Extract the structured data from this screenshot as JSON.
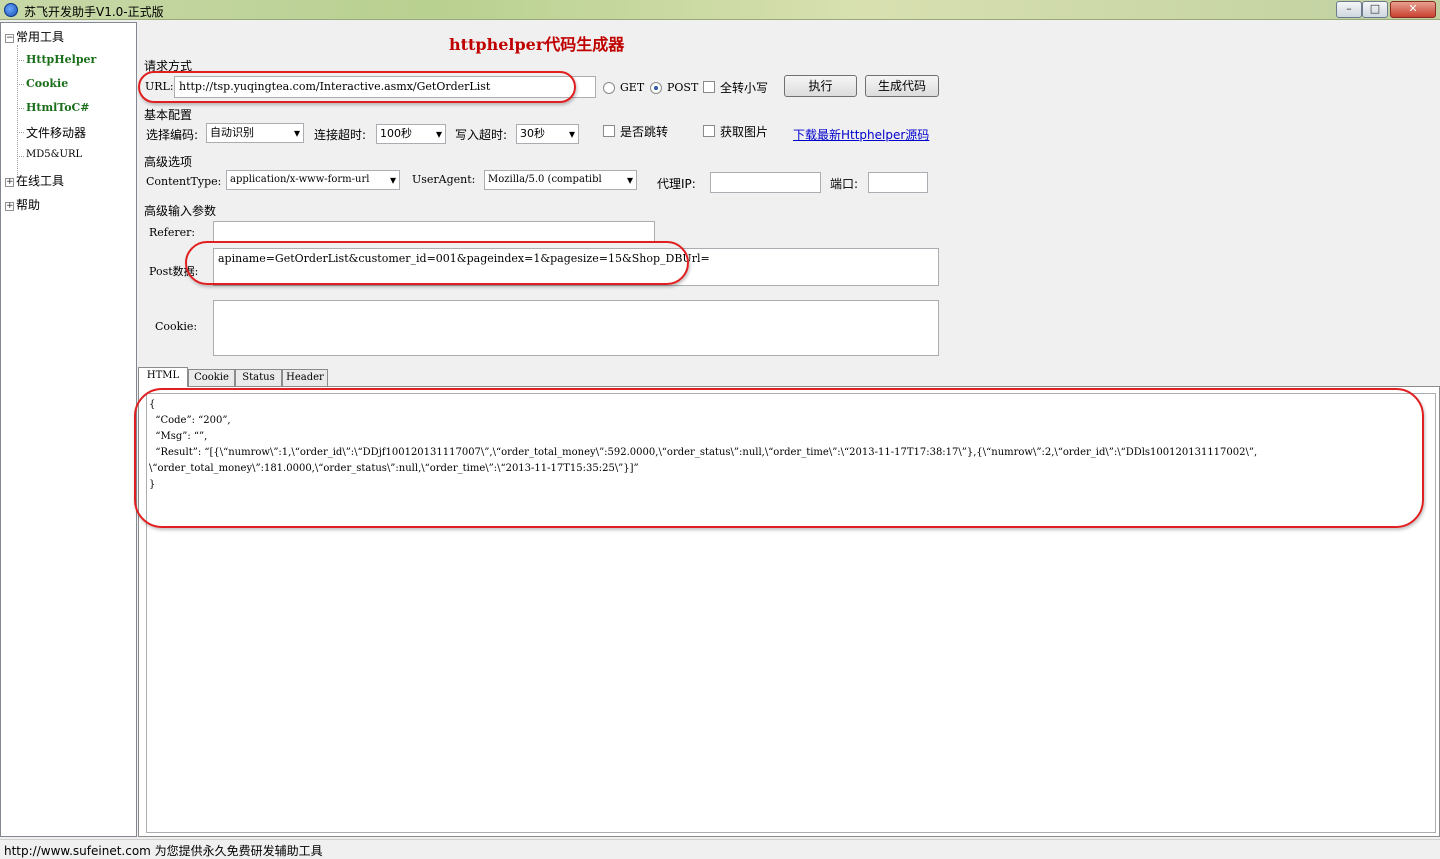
{
  "window": {
    "title": "苏飞开发助手V1.0-正式版",
    "controls": {
      "minimize": "–",
      "maximize": "□",
      "close": "✕"
    }
  },
  "sidebar": {
    "groups": [
      {
        "label": "常用工具",
        "toggle": "−",
        "expanded": true
      },
      {
        "label": "在线工具",
        "toggle": "+",
        "expanded": false
      },
      {
        "label": "帮助",
        "toggle": "+",
        "expanded": false
      }
    ],
    "items": [
      {
        "label": "HttpHelper"
      },
      {
        "label": "Cookie"
      },
      {
        "label": "HtmlToC#"
      },
      {
        "label": "文件移动器"
      },
      {
        "label": "MD5&URL"
      }
    ]
  },
  "main": {
    "title": "httphelper代码生成器",
    "request": {
      "section_label": "请求方式",
      "url_label": "URL:",
      "url_value": "http://tsp.yuqingtea.com/Interactive.asmx/GetOrderList",
      "get_label": "GET",
      "post_label": "POST",
      "method_selected": "POST",
      "lowercase_label": "全转小写",
      "lowercase_checked": false,
      "execute_button": "执行",
      "generate_button": "生成代码"
    },
    "basic": {
      "section_label": "基本配置",
      "encoding_label": "选择编码:",
      "encoding_value": "自动识别",
      "conn_timeout_label": "连接超时:",
      "conn_timeout_value": "100秒",
      "write_timeout_label": "写入超时:",
      "write_timeout_value": "30秒",
      "redirect_label": "是否跳转",
      "redirect_checked": false,
      "image_label": "获取图片",
      "image_checked": false,
      "download_link": "下载最新Httphelper源码"
    },
    "advanced": {
      "section_label": "高级选项",
      "content_type_label": "ContentType:",
      "content_type_value": "application/x-www-form-url",
      "user_agent_label": "UserAgent:",
      "user_agent_value": "Mozilla/5.0 (compatibl",
      "proxy_label": "代理IP:",
      "proxy_value": "",
      "port_label": "端口:",
      "port_value": ""
    },
    "params": {
      "section_label": "高级输入参数",
      "referer_label": "Referer:",
      "referer_value": "",
      "post_label": "Post数据:",
      "post_value": "apiname=GetOrderList&customer_id=001&pageindex=1&pagesize=15&Shop_DBUrl=",
      "cookie_label": "Cookie:",
      "cookie_value": ""
    },
    "tabs": [
      {
        "label": "HTML",
        "active": true
      },
      {
        "label": "Cookie",
        "active": false
      },
      {
        "label": "Status",
        "active": false
      },
      {
        "label": "Header",
        "active": false
      }
    ],
    "result_lines": [
      "{",
      "  “Code”: “200”,",
      "  “Msg”: “”,",
      "  “Result”: “[{\\“numrow\\”:1,\\“order_id\\”:\\“DDjf100120131117007\\”,\\“order_total_money\\”:592.0000,\\“order_status\\”:null,\\“order_time\\”:\\“2013-11-17T17:38:17\\”},{\\“numrow\\”:2,\\“order_id\\”:\\“DDls100120131117002\\”,",
      "\\“order_total_money\\”:181.0000,\\“order_status\\”:null,\\“order_time\\”:\\“2013-11-17T15:35:25\\”}]”",
      "}"
    ]
  },
  "statusbar": {
    "text": "http://www.sufeinet.com 为您提供永久免费研发辅助工具"
  },
  "colors": {
    "highlight_oval": "#e02020",
    "title_red": "#c00000",
    "tree_green": "#1a6e1a",
    "link_blue": "#0000cc"
  }
}
